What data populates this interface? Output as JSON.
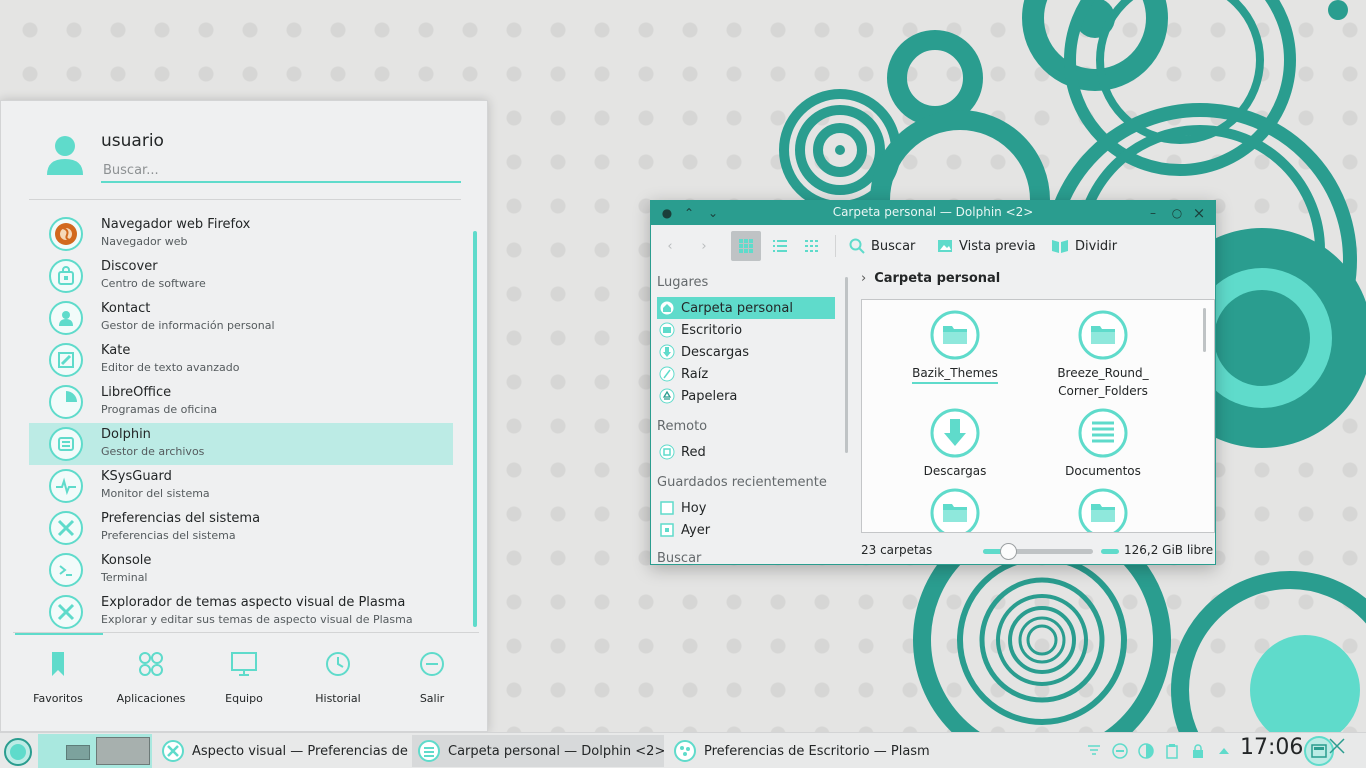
{
  "colors": {
    "accent": "#5fdbcb",
    "accent_dark": "#2a9d8f",
    "selection": "#bcebe5",
    "panel_bg": "#eff0f1"
  },
  "launcher": {
    "user_name": "usuario",
    "search_placeholder": "Buscar...",
    "apps": [
      {
        "name": "Navegador web Firefox",
        "description": "Navegador web",
        "icon": "firefox-icon"
      },
      {
        "name": "Discover",
        "description": "Centro de software",
        "icon": "discover-icon"
      },
      {
        "name": "Kontact",
        "description": "Gestor de información personal",
        "icon": "kontact-icon"
      },
      {
        "name": "Kate",
        "description": "Editor de texto avanzado",
        "icon": "kate-icon"
      },
      {
        "name": "LibreOffice",
        "description": "Programas de oficina",
        "icon": "libreoffice-icon"
      },
      {
        "name": "Dolphin",
        "description": "Gestor de archivos",
        "icon": "dolphin-icon",
        "selected": true
      },
      {
        "name": "KSysGuard",
        "description": "Monitor del sistema",
        "icon": "ksysguard-icon"
      },
      {
        "name": "Preferencias del sistema",
        "description": "Preferencias del sistema",
        "icon": "settings-icon"
      },
      {
        "name": "Konsole",
        "description": "Terminal",
        "icon": "konsole-icon"
      },
      {
        "name": "Explorador de temas aspecto visual de Plasma",
        "description": "Explorar y editar sus temas de aspecto visual de Plasma",
        "icon": "theme-explorer-icon"
      }
    ],
    "tabs": [
      {
        "label": "Favoritos",
        "icon": "bookmark-icon"
      },
      {
        "label": "Aplicaciones",
        "icon": "apps-grid-icon"
      },
      {
        "label": "Equipo",
        "icon": "computer-icon"
      },
      {
        "label": "Historial",
        "icon": "history-icon"
      },
      {
        "label": "Salir",
        "icon": "leave-icon"
      }
    ]
  },
  "dolphin": {
    "window_title": "Carpeta personal — Dolphin <2>",
    "toolbar": {
      "search": "Buscar",
      "preview": "Vista previa",
      "split": "Dividir"
    },
    "places": {
      "section_places": "Lugares",
      "items": [
        "Carpeta personal",
        "Escritorio",
        "Descargas",
        "Raíz",
        "Papelera"
      ],
      "section_remote": "Remoto",
      "remote_items": [
        "Red"
      ],
      "section_recent": "Guardados recientemente",
      "recent_items": [
        "Hoy",
        "Ayer"
      ],
      "section_search": "Buscar"
    },
    "breadcrumb": "Carpeta personal",
    "files": [
      {
        "name": "Bazik_Themes",
        "type": "folder"
      },
      {
        "name": "Breeze_Round_\nCorner_Folders",
        "type": "folder"
      },
      {
        "name": "Descargas",
        "type": "downloads"
      },
      {
        "name": "Documentos",
        "type": "documents"
      },
      {
        "name": "",
        "type": "folder"
      },
      {
        "name": "",
        "type": "folder"
      }
    ],
    "status": {
      "count": "23 carpetas",
      "free_space": "126,2 GiB libre",
      "zoom_fraction": 0.23
    }
  },
  "taskbar": {
    "tasks": [
      {
        "label": "Aspecto visual  — Preferencias del...",
        "icon": "settings-icon"
      },
      {
        "label": "Carpeta personal — Dolphin <2>",
        "icon": "dolphin-icon",
        "active": true
      },
      {
        "label": "Preferencias de Escritorio — Plasma",
        "icon": "plasma-icon"
      }
    ],
    "tray_icons": [
      "notifications-icon",
      "media-icon",
      "brightness-icon",
      "clipboard-icon",
      "battery-icon",
      "lock-icon",
      "expand-arrow-icon"
    ],
    "clock": "17:06"
  }
}
